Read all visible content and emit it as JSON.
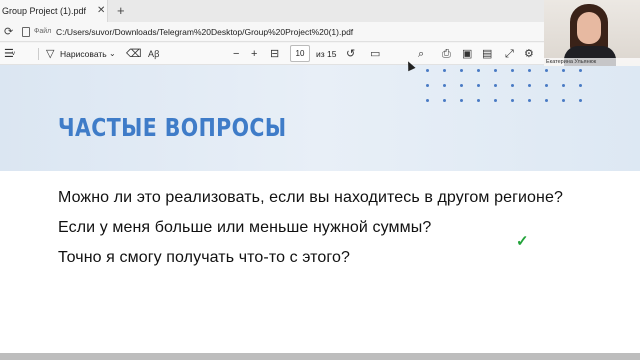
{
  "browser": {
    "tab_title": "Group Project (1).pdf",
    "tab_close": "✕",
    "new_tab": "+",
    "file_label": "Файл",
    "url": "C:/Users/suvor/Downloads/Telegram%20Desktop/Group%20Project%20(1).pdf"
  },
  "pdf_toolbar": {
    "draw_label": "Нарисовать",
    "zoom_out": "−",
    "zoom_in": "+",
    "page_current": "10",
    "page_total": "из 15"
  },
  "slide": {
    "title": "ЧАСТЫЕ ВОПРОСЫ",
    "questions": [
      "Можно ли это реализовать, если вы находитесь в другом регионе?",
      "Если у меня больше или меньше нужной суммы?",
      "Точно я смогу получать что-то с этого?"
    ],
    "check": "✓"
  },
  "video": {
    "name": "Екатерина Ульянюк"
  },
  "colors": {
    "title": "#3f7cc8",
    "check": "#22a33a",
    "header_bg": "#dbe6f2"
  }
}
